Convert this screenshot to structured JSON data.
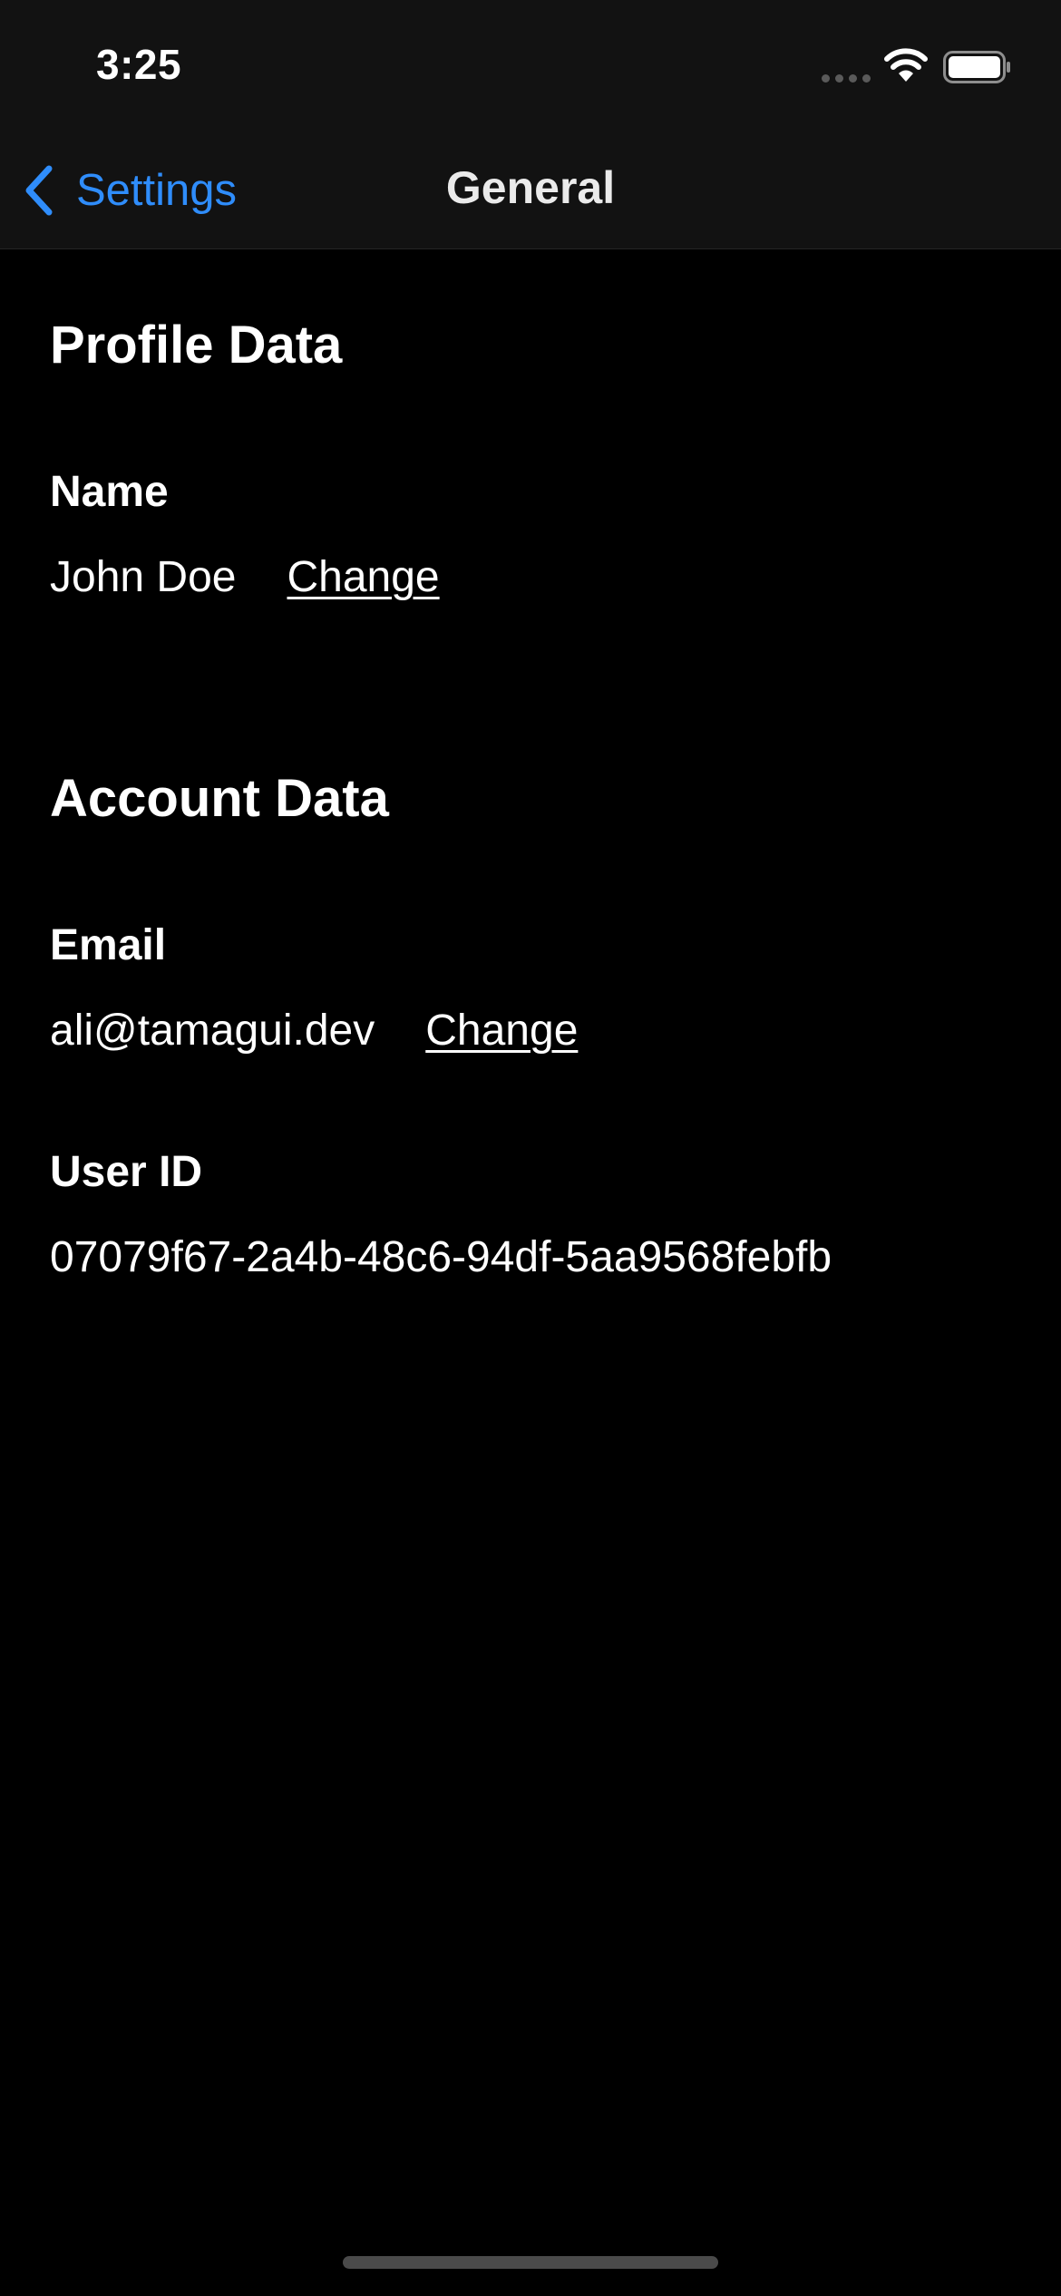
{
  "status_bar": {
    "time": "3:25",
    "icons": [
      "cellular-signal-icon",
      "wifi-icon",
      "battery-icon"
    ]
  },
  "nav": {
    "back_label": "Settings",
    "back_icon": "chevron-left-icon",
    "title": "General"
  },
  "profile": {
    "section_title": "Profile Data",
    "name_label": "Name",
    "name_value": "John Doe",
    "name_change": "Change"
  },
  "account": {
    "section_title": "Account Data",
    "email_label": "Email",
    "email_value": "ali@tamagui.dev",
    "email_change": "Change",
    "user_id_label": "User ID",
    "user_id_value": "07079f67-2a4b-48c6-94df-5aa9568febfb"
  },
  "colors": {
    "background": "#000000",
    "bar_background": "#121212",
    "accent": "#2f8dfb",
    "text": "#ffffff"
  }
}
